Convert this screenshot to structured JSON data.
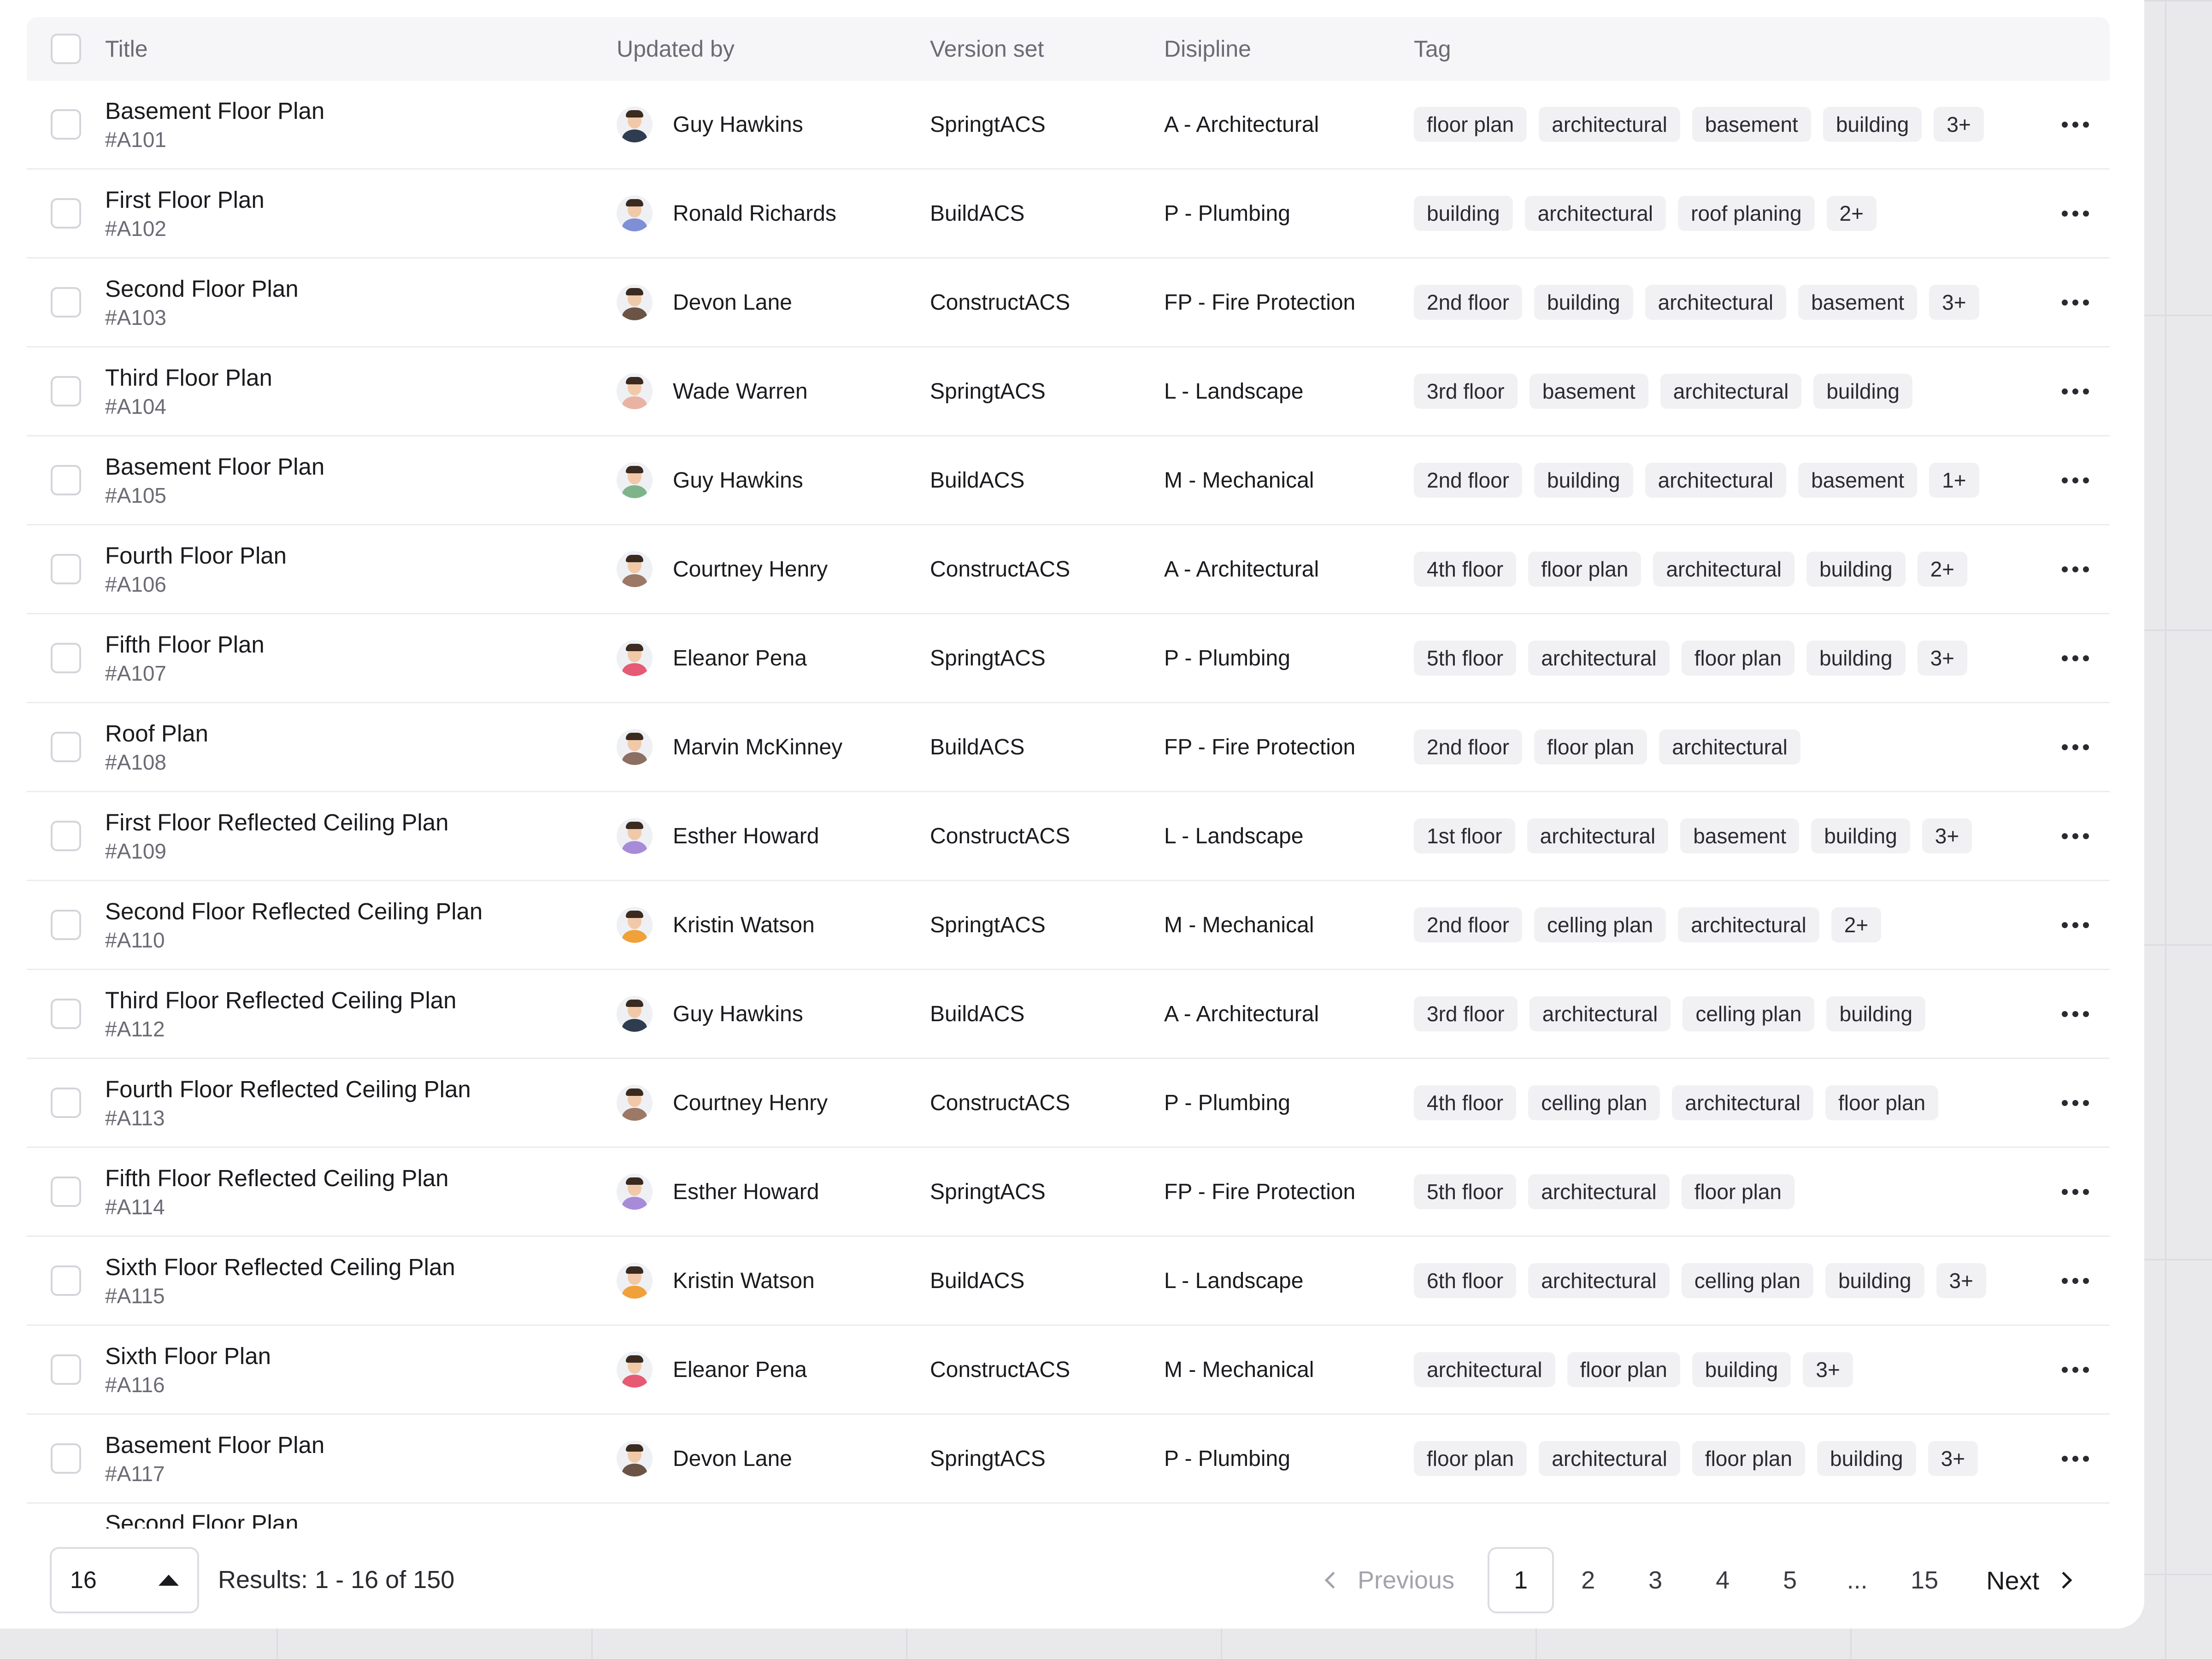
{
  "columns": {
    "title": "Title",
    "updated_by": "Updated by",
    "version_set": "Version set",
    "discipline": "Disipline",
    "tag": "Tag"
  },
  "rows": [
    {
      "title": "Basement Floor Plan",
      "id": "#A101",
      "user": "Guy Hawkins",
      "version": "SpringtACS",
      "discipline": "A - Architectural",
      "tags": [
        "floor plan",
        "architectural",
        "basement",
        "building",
        "3+"
      ],
      "avatar_color": "#2f3b4f"
    },
    {
      "title": "First Floor Plan",
      "id": "#A102",
      "user": "Ronald Richards",
      "version": "BuildACS",
      "discipline": "P - Plumbing",
      "tags": [
        "building",
        "architectural",
        "roof planing",
        "2+"
      ],
      "avatar_color": "#7e8fd6"
    },
    {
      "title": "Second Floor Plan",
      "id": "#A103",
      "user": "Devon Lane",
      "version": "ConstructACS",
      "discipline": "FP - Fire Protection",
      "tags": [
        "2nd floor",
        "building",
        "architectural",
        "basement",
        "3+"
      ],
      "avatar_color": "#6b5446"
    },
    {
      "title": "Third Floor Plan",
      "id": "#A104",
      "user": "Wade Warren",
      "version": "SpringtACS",
      "discipline": "L - Landscape",
      "tags": [
        "3rd floor",
        "basement",
        "architectural",
        "building"
      ],
      "avatar_color": "#e9b3a4"
    },
    {
      "title": "Basement Floor Plan",
      "id": "#A105",
      "user": "Guy Hawkins",
      "version": "BuildACS",
      "discipline": "M - Mechanical",
      "tags": [
        "2nd floor",
        "building",
        "architectural",
        "basement",
        "1+"
      ],
      "avatar_color": "#7fb48a"
    },
    {
      "title": "Fourth Floor Plan",
      "id": "#A106",
      "user": "Courtney Henry",
      "version": "ConstructACS",
      "discipline": "A - Architectural",
      "tags": [
        "4th floor",
        "floor plan",
        "architectural",
        "building",
        "2+"
      ],
      "avatar_color": "#9c7866"
    },
    {
      "title": "Fifth Floor Plan",
      "id": "#A107",
      "user": "Eleanor Pena",
      "version": "SpringtACS",
      "discipline": "P - Plumbing",
      "tags": [
        "5th floor",
        "architectural",
        "floor plan",
        "building",
        "3+"
      ],
      "avatar_color": "#e65a73"
    },
    {
      "title": "Roof Plan",
      "id": "#A108",
      "user": "Marvin McKinney",
      "version": "BuildACS",
      "discipline": "FP - Fire Protection",
      "tags": [
        "2nd floor",
        "floor plan",
        "architectural"
      ],
      "avatar_color": "#8c6e62"
    },
    {
      "title": "First Floor Reflected Ceiling Plan",
      "id": "#A109",
      "user": "Esther Howard",
      "version": "ConstructACS",
      "discipline": "L - Landscape",
      "tags": [
        "1st floor",
        "architectural",
        "basement",
        "building",
        "3+"
      ],
      "avatar_color": "#a78bd9"
    },
    {
      "title": "Second Floor Reflected Ceiling Plan",
      "id": "#A110",
      "user": "Kristin Watson",
      "version": "SpringtACS",
      "discipline": "M - Mechanical",
      "tags": [
        "2nd floor",
        "celling plan",
        "architectural",
        "2+"
      ],
      "avatar_color": "#f0a13a"
    },
    {
      "title": "Third Floor Reflected Ceiling Plan",
      "id": "#A112",
      "user": "Guy Hawkins",
      "version": "BuildACS",
      "discipline": "A - Architectural",
      "tags": [
        "3rd floor",
        "architectural",
        "celling plan",
        "building"
      ],
      "avatar_color": "#2f3b4f"
    },
    {
      "title": "Fourth Floor Reflected Ceiling Plan",
      "id": "#A113",
      "user": "Courtney Henry",
      "version": "ConstructACS",
      "discipline": "P - Plumbing",
      "tags": [
        "4th floor",
        "celling plan",
        "architectural",
        "floor plan"
      ],
      "avatar_color": "#9c7866"
    },
    {
      "title": "Fifth Floor Reflected Ceiling Plan",
      "id": "#A114",
      "user": "Esther Howard",
      "version": "SpringtACS",
      "discipline": "FP - Fire Protection",
      "tags": [
        "5th floor",
        "architectural",
        "floor plan"
      ],
      "avatar_color": "#a78bd9"
    },
    {
      "title": "Sixth Floor Reflected Ceiling Plan",
      "id": "#A115",
      "user": "Kristin Watson",
      "version": "BuildACS",
      "discipline": "L - Landscape",
      "tags": [
        "6th floor",
        "architectural",
        "celling plan",
        "building",
        "3+"
      ],
      "avatar_color": "#f0a13a"
    },
    {
      "title": "Sixth Floor Plan",
      "id": "#A116",
      "user": "Eleanor Pena",
      "version": "ConstructACS",
      "discipline": "M - Mechanical",
      "tags": [
        "architectural",
        "floor plan",
        "building",
        "3+"
      ],
      "avatar_color": "#e65a73"
    },
    {
      "title": "Basement Floor Plan",
      "id": "#A117",
      "user": "Devon Lane",
      "version": "SpringtACS",
      "discipline": "P - Plumbing",
      "tags": [
        "floor plan",
        "architectural",
        "floor plan",
        "building",
        "3+"
      ],
      "avatar_color": "#6b5446"
    }
  ],
  "partial_row": {
    "title": "Second Floor Plan"
  },
  "footer": {
    "page_size": "16",
    "results": "Results: 1 - 16 of 150",
    "previous": "Previous",
    "next": "Next",
    "pages": [
      "1",
      "2",
      "3",
      "4",
      "5",
      "...",
      "15"
    ],
    "current_page": "1"
  }
}
